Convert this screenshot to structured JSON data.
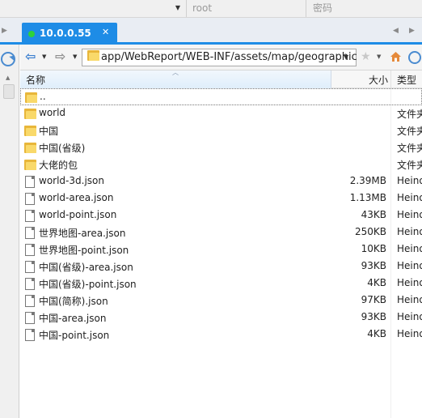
{
  "connection": {
    "username_placeholder": "root",
    "password_placeholder": "密码"
  },
  "tabs": [
    {
      "label": "10.0.0.55",
      "status_color": "#2ed23a",
      "active": true
    }
  ],
  "toolbar": {
    "path": "app/WebReport/WEB-INF/assets/map/geographic"
  },
  "columns": {
    "name": "名称",
    "size": "大小",
    "type": "类型"
  },
  "files": [
    {
      "name": "..",
      "size": "",
      "type": "",
      "kind": "folder"
    },
    {
      "name": "world",
      "size": "",
      "type": "文件夹",
      "kind": "folder"
    },
    {
      "name": "中国",
      "size": "",
      "type": "文件夹",
      "kind": "folder"
    },
    {
      "name": "中国(省级)",
      "size": "",
      "type": "文件夹",
      "kind": "folder"
    },
    {
      "name": "大佬的包",
      "size": "",
      "type": "文件夹",
      "kind": "folder"
    },
    {
      "name": "world-3d.json",
      "size": "2.39MB",
      "type": "Heinote",
      "kind": "file"
    },
    {
      "name": "world-area.json",
      "size": "1.13MB",
      "type": "Heinote",
      "kind": "file"
    },
    {
      "name": "world-point.json",
      "size": "43KB",
      "type": "Heinote",
      "kind": "file"
    },
    {
      "name": "世界地图-area.json",
      "size": "250KB",
      "type": "Heinote",
      "kind": "file"
    },
    {
      "name": "世界地图-point.json",
      "size": "10KB",
      "type": "Heinote",
      "kind": "file"
    },
    {
      "name": "中国(省级)-area.json",
      "size": "93KB",
      "type": "Heinote",
      "kind": "file"
    },
    {
      "name": "中国(省级)-point.json",
      "size": "4KB",
      "type": "Heinote",
      "kind": "file"
    },
    {
      "name": "中国(简称).json",
      "size": "97KB",
      "type": "Heinote",
      "kind": "file"
    },
    {
      "name": "中国-area.json",
      "size": "93KB",
      "type": "Heinote",
      "kind": "file"
    },
    {
      "name": "中国-point.json",
      "size": "4KB",
      "type": "Heinote",
      "kind": "file"
    }
  ],
  "colors": {
    "accent": "#1e8ce6",
    "folder": "#f9d96a"
  }
}
